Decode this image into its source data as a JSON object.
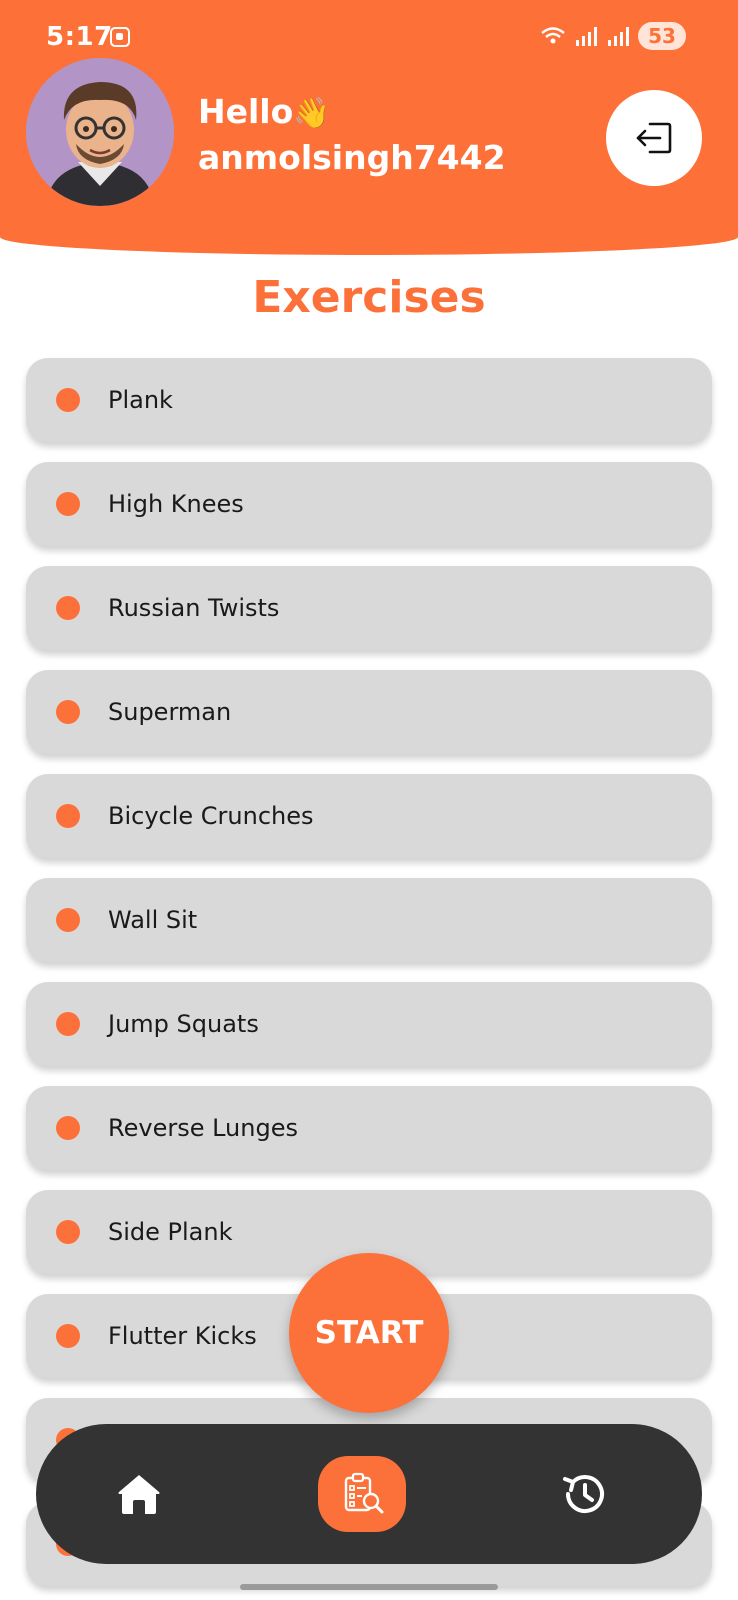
{
  "status_bar": {
    "time": "5:17",
    "battery": "53"
  },
  "header": {
    "greeting": "Hello",
    "wave_emoji": "👋",
    "username": "anmolsingh7442",
    "logout_icon": "logout-icon",
    "avatar_icon": "avatar"
  },
  "title": "Exercises",
  "exercises": [
    "Plank",
    "High Knees",
    "Russian Twists",
    "Superman",
    "Bicycle Crunches",
    "Wall Sit",
    "Jump Squats",
    "Reverse Lunges",
    "Side Plank",
    "Flutter Kicks",
    "",
    ""
  ],
  "start_label": "START",
  "bottom_nav": {
    "items": [
      {
        "icon": "home-icon",
        "active": false
      },
      {
        "icon": "search-list-icon",
        "active": true
      },
      {
        "icon": "history-icon",
        "active": false
      }
    ]
  },
  "colors": {
    "accent": "#FB7139",
    "nav_background": "#333333",
    "card": "#D9D9D9"
  }
}
